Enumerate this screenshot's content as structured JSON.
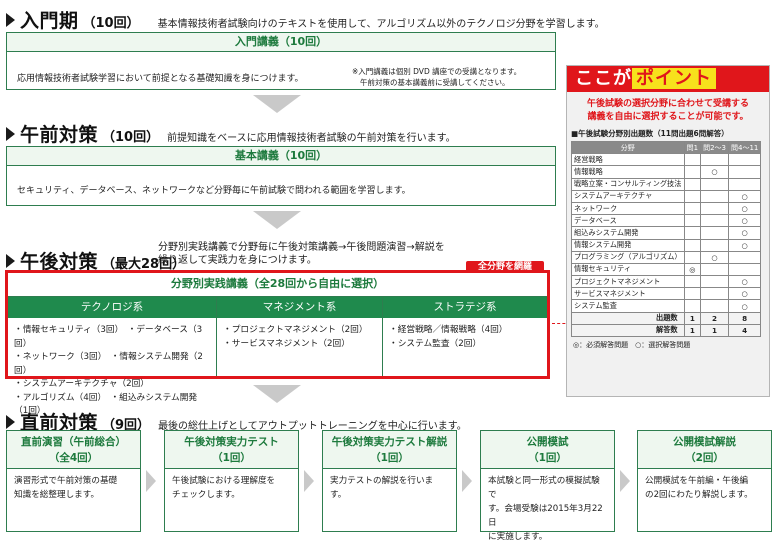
{
  "intro": {
    "title": "入門期",
    "count": "（10回）",
    "desc": "基本情報技術者試験向けのテキストを使用して、アルゴリズム以外のテクノロジ分野を学習します。",
    "box_title": "入門講義（10回）",
    "box_body": "応用情報技術者試験学習において前提となる基礎知識を身につけます。",
    "note_1": "※入門講義は個別 DVD 講座での受講となります。",
    "note_2": "午前対策の基本講義前に受講してください。"
  },
  "morning": {
    "title": "午前対策",
    "count": "（10回）",
    "desc": "前提知識をベースに応用情報技術者試験の午前対策を行います。",
    "box_title": "基本講義（10回）",
    "box_body": "セキュリティ、データベース、ネットワークなど分野毎に午前試験で問われる範囲を学習します。"
  },
  "afternoon": {
    "title": "午後対策",
    "count": "（最大28回）",
    "desc_1": "分野別実践講義で分野毎に午後対策講義→午後問題演習→解説を",
    "desc_2": "繰り返して実践力を身につけます。",
    "badge": "全分野を網羅",
    "box_title": "分野別実践講義（全28回から自由に選択）",
    "columns": [
      {
        "header": "テクノロジ系",
        "lines": [
          "・情報セキュリティ（3回）　・データベース（3回）",
          "・ネットワーク（3回）　・情報システム開発（2回）",
          "・システムアーキテクチャ（2回）",
          "・アルゴリズム（4回）　・組込みシステム開発（1回）"
        ]
      },
      {
        "header": "マネジメント系",
        "lines": [
          "・プロジェクトマネジメント（2回）",
          "・サービスマネジメント（2回）"
        ]
      },
      {
        "header": "ストラテジ系",
        "lines": [
          "・経営戦略／情報戦略（4回）",
          "・システム監査（2回）"
        ]
      }
    ]
  },
  "final": {
    "title": "直前対策",
    "count": "（9回）",
    "desc": "最後の総仕上げとしてアウトプットトレーニングを中心に行います。",
    "steps": [
      {
        "title_1": "直前演習（午前総合）",
        "title_2": "（全4回）",
        "body": [
          "演習形式で午前対策の基礎",
          "知識を総整理します。"
        ]
      },
      {
        "title_1": "午後対策実力テスト",
        "title_2": "（1回）",
        "body": [
          "午後試験における理解度を",
          "チェックします。"
        ]
      },
      {
        "title_1": "午後対策実力テスト解説",
        "title_2": "（1回）",
        "body": [
          "実力テストの解説を行います。"
        ]
      },
      {
        "title_1": "公開模試",
        "title_2": "（1回）",
        "body": [
          "本試験と同一形式の模擬試験で",
          "す。会場受験は2015年3月22日",
          "に実施します。"
        ]
      },
      {
        "title_1": "公開模試解説",
        "title_2": "（2回）",
        "body": [
          "公開模試を午前編・午後編",
          "の2回にわたり解説します。"
        ]
      }
    ]
  },
  "point": {
    "header_pre": "ここが",
    "header_hl": "ポイント",
    "lead_1": "午後試験の選択分野に合わせて受講する",
    "lead_2": "講義を自由に選択することが可能です。",
    "table_title": "■午後試験分野別出題数（11問出題6問解答）",
    "columns": [
      "分野",
      "問1",
      "問2～3",
      "問4～11"
    ],
    "rows": [
      {
        "name": "経営戦略",
        "q1": "",
        "q23": "",
        "q411": ""
      },
      {
        "name": "情報戦略",
        "q1": "",
        "q23": "○",
        "q411": ""
      },
      {
        "name": "戦略立案・コンサルティング技法",
        "q1": "",
        "q23": "",
        "q411": ""
      },
      {
        "name": "システムアーキテクチャ",
        "q1": "",
        "q23": "",
        "q411": "○"
      },
      {
        "name": "ネットワーク",
        "q1": "",
        "q23": "",
        "q411": "○"
      },
      {
        "name": "データベース",
        "q1": "",
        "q23": "",
        "q411": "○"
      },
      {
        "name": "組込みシステム開発",
        "q1": "",
        "q23": "",
        "q411": "○"
      },
      {
        "name": "情報システム開発",
        "q1": "",
        "q23": "",
        "q411": "○"
      },
      {
        "name": "プログラミング（アルゴリズム）",
        "q1": "",
        "q23": "○",
        "q411": ""
      },
      {
        "name": "情報セキュリティ",
        "q1": "◎",
        "q23": "",
        "q411": ""
      },
      {
        "name": "プロジェクトマネジメント",
        "q1": "",
        "q23": "",
        "q411": "○"
      },
      {
        "name": "サービスマネジメント",
        "q1": "",
        "q23": "",
        "q411": "○"
      },
      {
        "name": "システム監査",
        "q1": "",
        "q23": "",
        "q411": "○"
      }
    ],
    "sum_rows": [
      {
        "label": "出題数",
        "q1": "1",
        "q23": "2",
        "q411": "8"
      },
      {
        "label": "解答数",
        "q1": "1",
        "q23": "1",
        "q411": "4"
      }
    ],
    "legend": "◎：必須解答問題　○：選択解答問題"
  }
}
